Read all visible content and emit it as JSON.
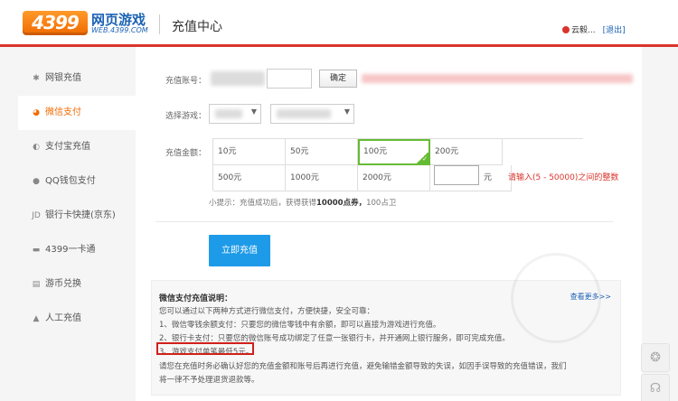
{
  "header": {
    "logo_num": "4399",
    "logo_cn": "网页游戏",
    "logo_en": "WEB.4399.COM",
    "page_title": "充值中心",
    "username": "云毅...",
    "logout": "[退出]"
  },
  "sidebar": {
    "items": [
      {
        "label": "网银充值",
        "icon": "star-icon"
      },
      {
        "label": "微信支付",
        "icon": "wechat-icon",
        "active": true
      },
      {
        "label": "支付宝充值",
        "icon": "alipay-icon"
      },
      {
        "label": "QQ钱包支付",
        "icon": "qq-wallet-icon"
      },
      {
        "label": "银行卡快捷(京东)",
        "icon": "jd-icon"
      },
      {
        "label": "4399一卡通",
        "icon": "card-icon"
      },
      {
        "label": "游币兑换",
        "icon": "exchange-icon"
      },
      {
        "label": "人工充值",
        "icon": "person-icon"
      }
    ]
  },
  "form": {
    "account_label": "充值账号：",
    "confirm_btn": "确定",
    "game_label": "选择游戏：",
    "amount_label": "充值金额：",
    "amounts": [
      "10元",
      "50元",
      "100元",
      "200元",
      "500元",
      "1000元",
      "2000元"
    ],
    "selected_amount": "100元",
    "unit": "元",
    "range_hint": "请输入(5 - 50000)之间的整数",
    "tip_prefix": "小提示：充值成功后，获得获得",
    "tip_bold": "10000点券，",
    "tip_suffix": "100占卫",
    "submit": "立即充值"
  },
  "info": {
    "title": "微信支付充值说明：",
    "more": "查看更多>>",
    "lines": [
      "您可以通过以下两种方式进行微信支付，方便快捷，安全可靠：",
      "1、微信零钱余额支付：只要您的微信零钱中有余额，即可以直接为游戏进行充值。",
      "2、银行卡支付：只要您的微信账号成功绑定了任意一张银行卡，并开通网上银行服务，即可完成充值。",
      "3、游戏支付单笔最低5元。",
      "请您在充值时务必确认好您的充值金额和账号后再进行充值，避免输错金额导致的失误，如因手误导致的充值错误，我们",
      "将一律不予处理退货退款等。"
    ]
  },
  "colors": {
    "brand_red": "#d9352c",
    "active_orange": "#f06a00",
    "primary_blue": "#1e9be8",
    "selected_green": "#66bb35"
  }
}
